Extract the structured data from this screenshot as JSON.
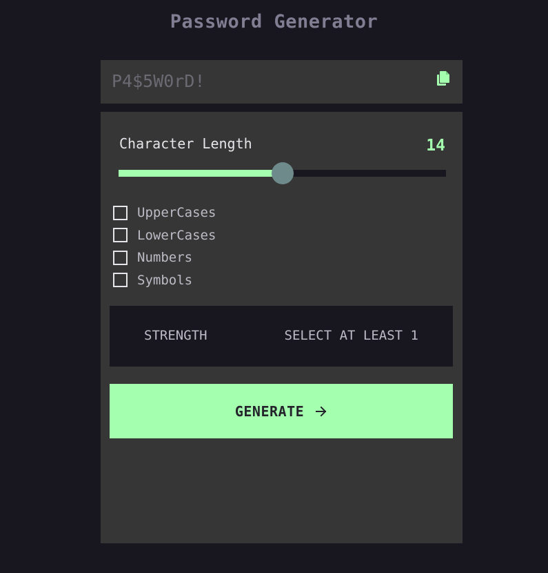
{
  "app": {
    "title": "Password Generator"
  },
  "output": {
    "password": "P4$5W0rD!",
    "copy_icon": "copy-icon"
  },
  "length": {
    "label": "Character Length",
    "value": "14",
    "slider_fill_percent": 50
  },
  "options": [
    {
      "label": "UpperCases",
      "checked": false
    },
    {
      "label": "LowerCases",
      "checked": false
    },
    {
      "label": "Numbers",
      "checked": false
    },
    {
      "label": "Symbols",
      "checked": false
    }
  ],
  "strength": {
    "label": "STRENGTH",
    "value": "SELECT AT LEAST 1"
  },
  "generate": {
    "label": "GENERATE",
    "icon": "arrow-right-icon"
  },
  "colors": {
    "background": "#18171f",
    "panel": "#363636",
    "accent": "#a4ffaf",
    "thumb": "#6e8a8b",
    "text": "#e6e5ea",
    "muted": "#817d92"
  }
}
